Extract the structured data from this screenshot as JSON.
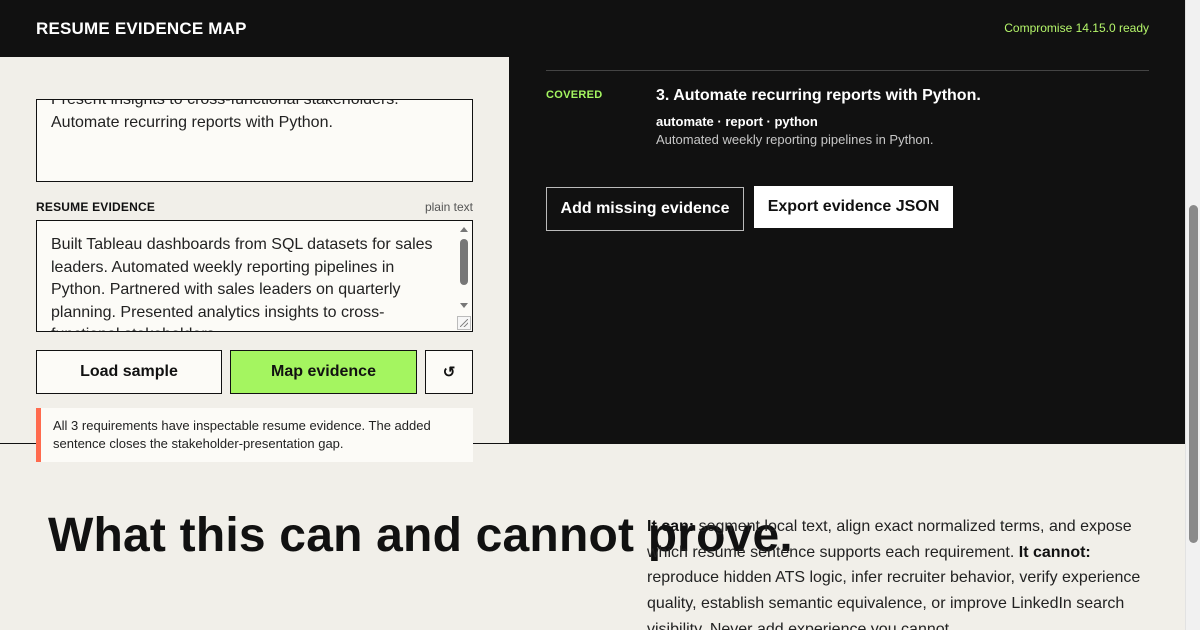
{
  "header": {
    "title": "RESUME EVIDENCE MAP",
    "status": "Compromise 14.15.0 ready"
  },
  "requirements_input": {
    "line1": "Present insights to cross-functional stakeholders.",
    "line2": "Automate recurring reports with Python."
  },
  "resume_section": {
    "label": "RESUME EVIDENCE",
    "hint": "plain text",
    "text": "Built Tableau dashboards from SQL datasets for sales leaders. Automated weekly reporting pipelines in Python. Partnered with sales leaders on quarterly planning. Presented analytics insights to cross-functional stakeholders."
  },
  "buttons": {
    "load_sample": "Load sample",
    "map_evidence": "Map evidence",
    "reset": "↺",
    "add_missing": "Add missing evidence",
    "export_json": "Export evidence JSON"
  },
  "notice": {
    "text": "All 3 requirements have inspectable resume evidence. The added sentence closes the stakeholder-presentation gap."
  },
  "results": {
    "items": [
      {
        "status": "COVERED",
        "title": "3. Automate recurring reports with Python.",
        "terms": "automate · report · python",
        "evidence": "Automated weekly reporting pipelines in Python."
      }
    ]
  },
  "limits": {
    "heading": "What this can and cannot prove.",
    "can_label": "It can:",
    "can_text": " segment local text, align exact normalized terms, and expose which resume sentence supports each requirement. ",
    "cannot_label": "It cannot:",
    "cannot_text": " reproduce hidden ATS logic, infer recruiter behavior, verify experience quality, establish semantic equivalence, or improve LinkedIn search visibility. Never add experience you cannot"
  },
  "colors": {
    "accent_green": "#a4f560",
    "alert_red": "#ff6a4d",
    "dark": "#111111",
    "paper": "#f1efe9"
  }
}
